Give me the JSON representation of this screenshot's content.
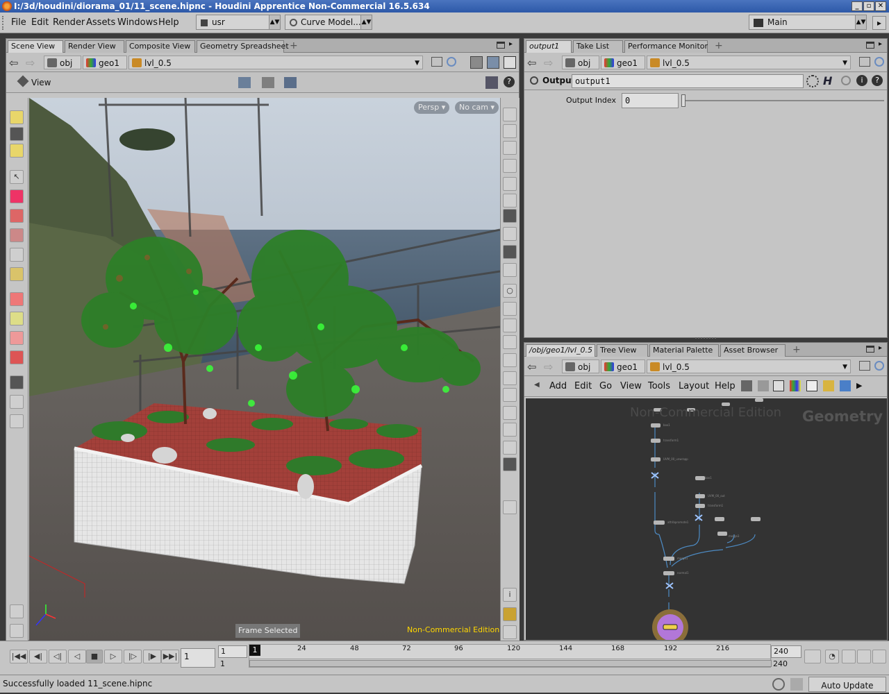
{
  "window": {
    "title": "I:/3d/houdini/diorama_01/11_scene.hipnc - Houdini Apprentice Non-Commercial 16.5.634"
  },
  "menu": {
    "items": [
      "File",
      "Edit",
      "Render",
      "Assets",
      "Windows",
      "Help"
    ],
    "desktop": "usr",
    "shelfset": "Curve Model...",
    "context": "Main"
  },
  "left_panel": {
    "tabs": [
      "Scene View",
      "Render View",
      "Composite View",
      "Geometry Spreadsheet"
    ],
    "path": [
      "obj",
      "geo1",
      "lvl_0.5"
    ],
    "view_label": "View",
    "persp": "Persp ▾",
    "nocam": "No cam ▾",
    "frame_selected": "Frame Selected",
    "watermark": "Non-Commercial Edition"
  },
  "params_panel": {
    "tabs": [
      "output1",
      "Take List",
      "Performance Monitor"
    ],
    "path": [
      "obj",
      "geo1",
      "lvl_0.5"
    ],
    "node_type": "Output",
    "node_name": "output1",
    "param_label": "Output Index",
    "param_value": "0"
  },
  "network_panel": {
    "tabs": [
      "/obj/geo1/lvl_0.5",
      "Tree View",
      "Material Palette",
      "Asset Browser"
    ],
    "path": [
      "obj",
      "geo1",
      "lvl_0.5"
    ],
    "menu": [
      "Add",
      "Edit",
      "Go",
      "View",
      "Tools",
      "Layout",
      "Help"
    ],
    "watermark": "Non-Commercial Edition",
    "context_label": "Geometry"
  },
  "timeline": {
    "current_frame": "1",
    "start": "1",
    "range_start": "1",
    "range_end": "240",
    "end": "240",
    "marker": "1",
    "ticks": [
      "24",
      "48",
      "72",
      "96",
      "120",
      "144",
      "168",
      "192",
      "216"
    ]
  },
  "status": {
    "message": "Successfully loaded 11_scene.hipnc",
    "update_mode": "Auto Update"
  },
  "colors": {
    "title": "#3a66b5",
    "foliage": "#2f8a2a",
    "bright_leaf": "#3aff3a",
    "soil": "#a3403a",
    "planter": "#e0e0e0"
  }
}
